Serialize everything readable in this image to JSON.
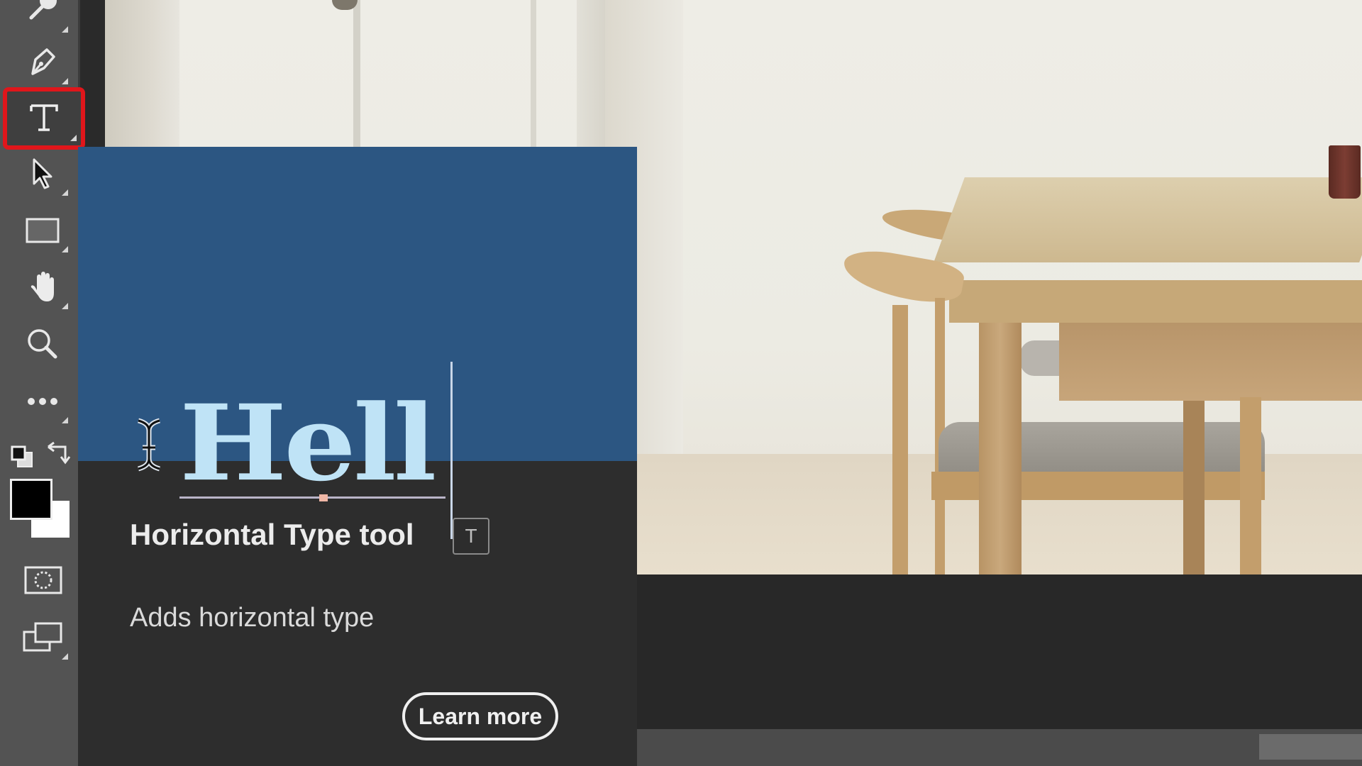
{
  "toolbar": {
    "tools": [
      {
        "name": "quick-selection",
        "icon": "brush-selection-icon",
        "selected": false
      },
      {
        "name": "pen",
        "icon": "pen-icon",
        "selected": false
      },
      {
        "name": "horizontal-type",
        "icon": "type-icon",
        "selected": true
      },
      {
        "name": "path-selection",
        "icon": "arrow-pointer-icon",
        "selected": false
      },
      {
        "name": "rectangle",
        "icon": "rectangle-icon",
        "selected": false
      },
      {
        "name": "hand",
        "icon": "hand-icon",
        "selected": false
      },
      {
        "name": "zoom",
        "icon": "magnifier-icon",
        "selected": false
      },
      {
        "name": "edit-toolbar",
        "icon": "more-icon",
        "selected": false
      }
    ],
    "foreground_color": "#000000",
    "background_color": "#ffffff",
    "highlight_color": "#e0161b"
  },
  "tooltip": {
    "preview_text": "Hell",
    "title": "Horizontal Type tool",
    "shortcut": "T",
    "description": "Adds horizontal type",
    "learn_more_label": "Learn more",
    "preview_bg": "#2c5682",
    "preview_text_color": "#bfe3f6"
  },
  "canvas": {
    "image_description": "Dining room with wooden table and chairs"
  }
}
